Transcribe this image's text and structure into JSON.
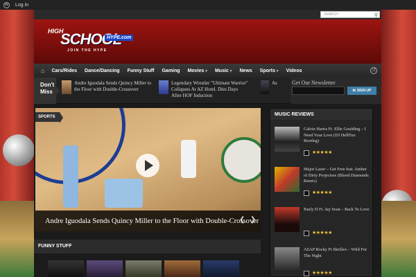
{
  "admin_bar": {
    "login": "Log in"
  },
  "search": {
    "placeholder": "SEARCH"
  },
  "logo": {
    "line1": "HIGH",
    "line2": "SCHOOL",
    "line3": "HYPE.com",
    "tagline": "JOIN THE HYPE"
  },
  "nav": {
    "items": [
      {
        "label": "Cars/Rides"
      },
      {
        "label": "Dance/Dancing"
      },
      {
        "label": "Funny Stuff"
      },
      {
        "label": "Gaming"
      },
      {
        "label": "Movies"
      },
      {
        "label": "Music"
      },
      {
        "label": "News"
      },
      {
        "label": "Sports"
      },
      {
        "label": "Videos"
      }
    ]
  },
  "dont_miss": {
    "label": "Don't Miss",
    "items": [
      {
        "title": "Andre Iguodala Sends Quincy Miller to the Floor with Double-Crossover"
      },
      {
        "title": "Legendary Wrestler \"Ultimate Warrior\" Collapses At AZ Hotel. Dies Days After HOF Induction"
      },
      {
        "title": "As"
      }
    ]
  },
  "newsletter": {
    "title": "Get Our Newsletter",
    "button": "SIGN UP"
  },
  "featured": {
    "category": "SPORTS",
    "title": "Andre Iguodala Sends Quincy Miller to the Floor with Double-Crossover"
  },
  "funny_stuff": {
    "header": "FUNNY STUFF"
  },
  "music_reviews": {
    "header": "MUSIC REVIEWS",
    "items": [
      {
        "title": "Calvin Harris Ft. Ellie Goulding – I Need Your Love (DJ HellFire Bootleg)",
        "stars": "★★★★★",
        "rating": 3.5
      },
      {
        "title": "Major Lazer – Get Free feat. Amber of Dirty Projectors (Blood Diamonds Remix)",
        "stars": "★★★★★",
        "rating": 4
      },
      {
        "title": "Pauly D Ft. Jay Sean – Back To Love",
        "stars": "★★★★★",
        "rating": 3.5
      },
      {
        "title": "ASAP Rocky Ft Skrillex – Wild For The Night",
        "stars": "★★★★★",
        "rating": 4
      }
    ]
  },
  "colors": {
    "header_red": "#9e1410",
    "accent_blue": "#3f7fa8",
    "star": "#f3c43a"
  }
}
